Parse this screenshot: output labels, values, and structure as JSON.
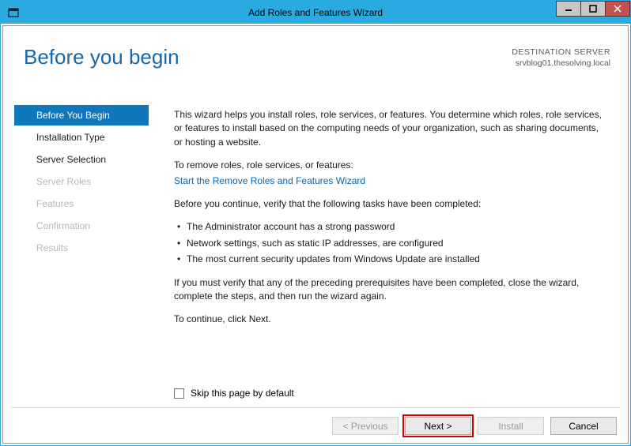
{
  "titlebar": {
    "title": "Add Roles and Features Wizard"
  },
  "header": {
    "title": "Before you begin",
    "dest_label": "DESTINATION SERVER",
    "dest_server": "srvblog01.thesolving.local"
  },
  "nav": {
    "items": [
      {
        "label": "Before You Begin",
        "state": "selected"
      },
      {
        "label": "Installation Type",
        "state": "enabled"
      },
      {
        "label": "Server Selection",
        "state": "enabled"
      },
      {
        "label": "Server Roles",
        "state": "disabled"
      },
      {
        "label": "Features",
        "state": "disabled"
      },
      {
        "label": "Confirmation",
        "state": "disabled"
      },
      {
        "label": "Results",
        "state": "disabled"
      }
    ]
  },
  "content": {
    "intro": "This wizard helps you install roles, role services, or features. You determine which roles, role services, or features to install based on the computing needs of your organization, such as sharing documents, or hosting a website.",
    "remove_lead": "To remove roles, role services, or features:",
    "remove_link": "Start the Remove Roles and Features Wizard",
    "verify_lead": "Before you continue, verify that the following tasks have been completed:",
    "bullets": {
      "b0": "The Administrator account has a strong password",
      "b1": "Network settings, such as static IP addresses, are configured",
      "b2": "The most current security updates from Windows Update are installed"
    },
    "ifmust": "If you must verify that any of the preceding prerequisites have been completed, close the wizard, complete the steps, and then run the wizard again.",
    "tocontinue": "To continue, click Next.",
    "skip_label": "Skip this page by default"
  },
  "buttons": {
    "previous": "< Previous",
    "next": "Next >",
    "install": "Install",
    "cancel": "Cancel"
  }
}
